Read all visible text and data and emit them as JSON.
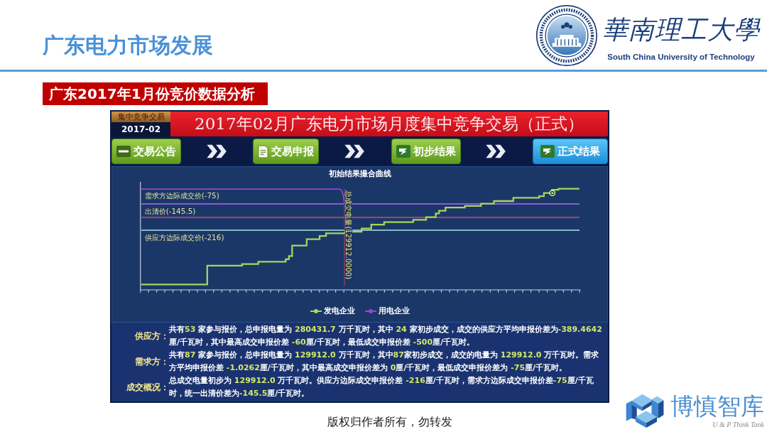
{
  "header": {
    "title": "广东电力市场发展",
    "logo_name": "華南理工大學",
    "logo_subtitle": "South China University of Technology"
  },
  "section_label": "广东2017年1月份竞价数据分析",
  "screen": {
    "badge": {
      "caption": "集中竞争交易",
      "period": "2017-02"
    },
    "banner": "2017年02月广东电力市场月度集中竞争交易（正式）",
    "steps": [
      {
        "label": "交易公告",
        "selected": false
      },
      {
        "label": "交易申报",
        "selected": false
      },
      {
        "label": "初步结果",
        "selected": false
      },
      {
        "label": "正式结果",
        "selected": true
      }
    ],
    "chart": {
      "title": "初始结果撮合曲线",
      "reference_lines": [
        {
          "label": "需求方边际成交价(-75)",
          "color": "#8a5ad6"
        },
        {
          "label": "出清价(-145.5)",
          "color": "#a8406e"
        },
        {
          "label": "供应方边际成交价(-216)",
          "color": "#86b8c8"
        }
      ],
      "crossing_label": "总成交电量(129912.0000)",
      "legend": [
        {
          "label": "发电企业",
          "color": "#a6d65a"
        },
        {
          "label": "用电企业",
          "color": "#a040d0"
        }
      ]
    },
    "summary": [
      {
        "label": "供应方：",
        "segments": [
          {
            "text": "共有",
            "highlight": false
          },
          {
            "text": "53",
            "highlight": true
          },
          {
            "text": " 家参与报价，总申报电量为 ",
            "highlight": false
          },
          {
            "text": "280431.7",
            "highlight": true
          },
          {
            "text": " 万千瓦时，其中 ",
            "highlight": false
          },
          {
            "text": "24",
            "highlight": true
          },
          {
            "text": " 家初步成交，成交的供应方平均申报价差为",
            "highlight": false
          },
          {
            "text": "-389.4642",
            "highlight": true
          },
          {
            "text": "厘/千瓦时，其中最高成交申报价差 ",
            "highlight": false
          },
          {
            "text": "-60",
            "highlight": true
          },
          {
            "text": "厘/千瓦时，最低成交申报价差 ",
            "highlight": false
          },
          {
            "text": "-500",
            "highlight": true
          },
          {
            "text": "厘/千瓦时。",
            "highlight": false
          }
        ]
      },
      {
        "label": "需求方：",
        "segments": [
          {
            "text": "共有",
            "highlight": false
          },
          {
            "text": "87",
            "highlight": true
          },
          {
            "text": " 家参与报价，总申报电量为 ",
            "highlight": false
          },
          {
            "text": "129912.0",
            "highlight": true
          },
          {
            "text": " 万千瓦时，其中",
            "highlight": false
          },
          {
            "text": "87",
            "highlight": true
          },
          {
            "text": "家初步成交，成交的电量为 ",
            "highlight": false
          },
          {
            "text": "129912.0",
            "highlight": true
          },
          {
            "text": " 万千瓦时。需求方平均申报价差 ",
            "highlight": false
          },
          {
            "text": "-1.0262",
            "highlight": true
          },
          {
            "text": "厘/千瓦时，其中最高成交申报价差为 ",
            "highlight": false
          },
          {
            "text": "0",
            "highlight": true
          },
          {
            "text": "厘/千瓦时，最低成交申报价差为 ",
            "highlight": false
          },
          {
            "text": "-75",
            "highlight": true
          },
          {
            "text": "厘/千瓦时。",
            "highlight": false
          }
        ]
      },
      {
        "label": "成交概况：",
        "segments": [
          {
            "text": "总成交电量初步为 ",
            "highlight": false
          },
          {
            "text": "129912.0",
            "highlight": true
          },
          {
            "text": " 万千瓦时。供应方边际成交申报价差 ",
            "highlight": false
          },
          {
            "text": "-216",
            "highlight": true
          },
          {
            "text": "厘/千瓦时，需求方边际成交申报价差",
            "highlight": false
          },
          {
            "text": "-75",
            "highlight": true
          },
          {
            "text": "厘/千瓦时，统一出清价差为",
            "highlight": false
          },
          {
            "text": "-145.5",
            "highlight": true
          },
          {
            "text": "厘/千瓦时。",
            "highlight": false
          }
        ]
      }
    ]
  },
  "footer": "版权归作者所有，勿转发",
  "think_tank": {
    "name": "博慎智库",
    "tagline": "U & P Think Tank"
  }
}
